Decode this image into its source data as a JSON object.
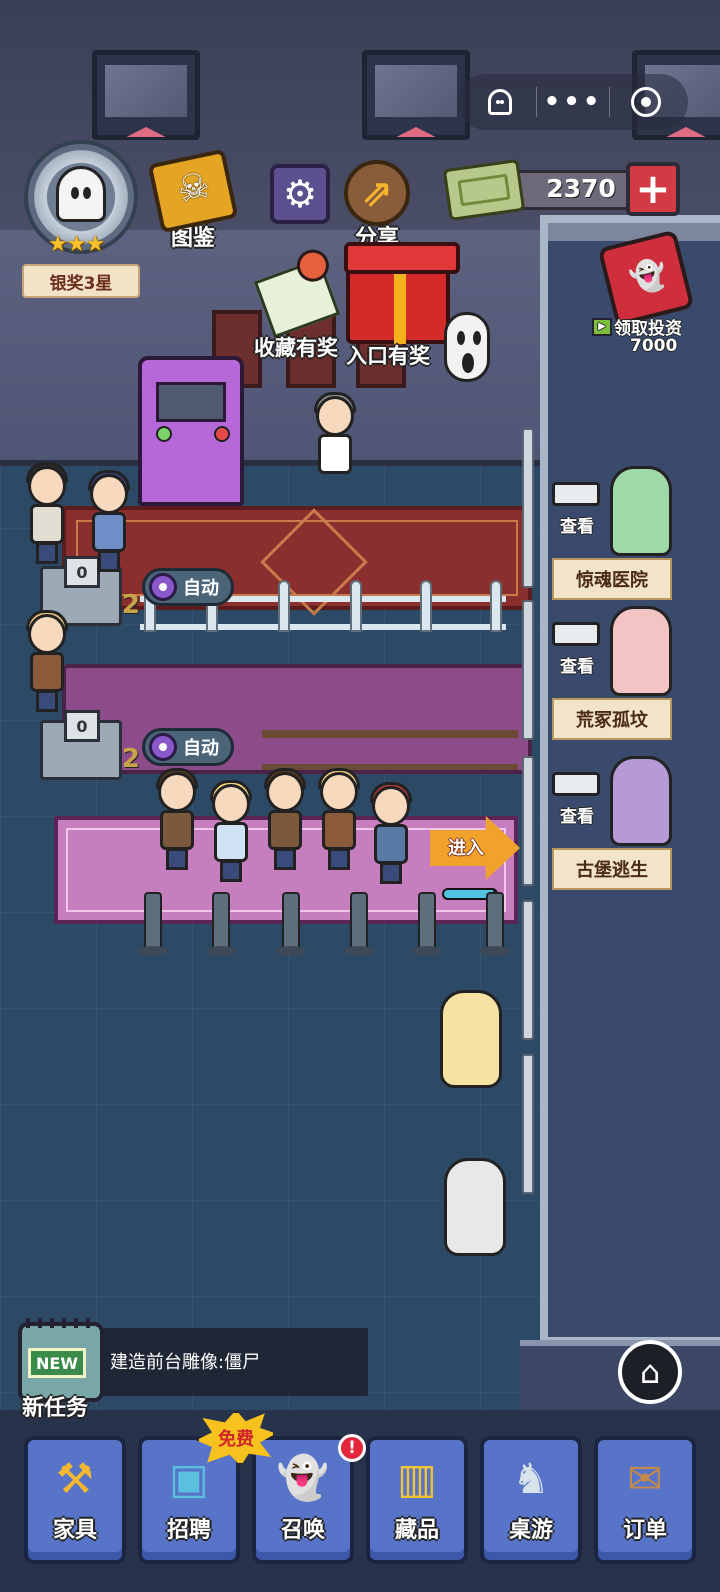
{
  "top_capsule": {
    "ghost_icon": "ghost-icon",
    "menu_icon": "more-dots-icon",
    "close_icon": "target-circle-icon"
  },
  "badge": {
    "label": "银奖3星",
    "stars": "★★★"
  },
  "toolbar": {
    "handbook_label": "图鉴",
    "share_label": "分享",
    "gear_glyph": "⚙",
    "share_glyph": "⇗"
  },
  "currency": {
    "amount": "2370",
    "plus_glyph": "+"
  },
  "invest": {
    "label": "领取投资",
    "amount": "7000",
    "play_glyph": "▶"
  },
  "rewards": {
    "collect_label": "收藏有奖",
    "entrance_label": "入口有奖"
  },
  "queues": [
    {
      "count": "0",
      "level": "2",
      "auto_label": "自动"
    },
    {
      "count": "0",
      "level": "2",
      "auto_label": "自动"
    }
  ],
  "enter": {
    "label": "进入",
    "progress_fraction": 0.95
  },
  "scenes": [
    {
      "view_label": "查看",
      "name": "惊魂医院",
      "color": "#9fd9a9"
    },
    {
      "view_label": "查看",
      "name": "荒冢孤坟",
      "color": "#f2c4c4"
    },
    {
      "view_label": "查看",
      "name": "古堡逃生",
      "color": "#b59ad6"
    }
  ],
  "task": {
    "new_badge": "NEW",
    "description": "建造前台雕像:僵尸",
    "label": "新任务"
  },
  "home": {
    "glyph": "⌂"
  },
  "free_badge": "免费",
  "alert_badge": "!",
  "nav": [
    {
      "label": "家具",
      "icon": "⚒",
      "color": "#f5b82e"
    },
    {
      "label": "招聘",
      "icon": "▣",
      "color": "#5bc0de"
    },
    {
      "label": "召唤",
      "icon": "👻",
      "color": "#e9f2f7"
    },
    {
      "label": "藏品",
      "icon": "▥",
      "color": "#f2c531"
    },
    {
      "label": "桌游",
      "icon": "♞",
      "color": "#d8e2ea"
    },
    {
      "label": "订单",
      "icon": "✉",
      "color": "#c58a4a"
    }
  ],
  "colors": {
    "accent_red": "#d33a44",
    "floor": "#2c4a66",
    "button_blue": "#5874c8"
  }
}
